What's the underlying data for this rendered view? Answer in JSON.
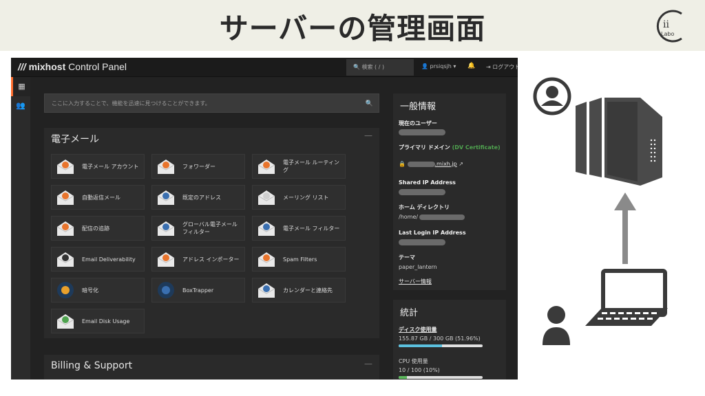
{
  "banner": {
    "title": "サーバーの管理画面",
    "logo_text": "Labo"
  },
  "topbar": {
    "brand": "mixhost",
    "brand_suffix": " Control Panel",
    "search_placeholder": "検索 ( / )",
    "user": "prsiqsjh",
    "logout": "ログアウト"
  },
  "quick_search": {
    "placeholder": "ここに入力することで、機能を迅速に見つけることができます。"
  },
  "email_panel": {
    "title": "電子メール",
    "tiles": [
      {
        "label": "電子メール アカウント",
        "icon": "email-accounts-icon"
      },
      {
        "label": "フォワーダー",
        "icon": "forwarders-icon"
      },
      {
        "label": "電子メール ルーティング",
        "icon": "email-routing-icon"
      },
      {
        "label": "自動返信メール",
        "icon": "autoresponders-icon"
      },
      {
        "label": "既定のアドレス",
        "icon": "default-address-icon"
      },
      {
        "label": "メーリング リスト",
        "icon": "mailing-lists-icon"
      },
      {
        "label": "配信の追跡",
        "icon": "track-delivery-icon"
      },
      {
        "label": "グローバル電子メール フィルター",
        "icon": "global-filters-icon"
      },
      {
        "label": "電子メール フィルター",
        "icon": "email-filters-icon"
      },
      {
        "label": "Email Deliverability",
        "icon": "deliverability-icon"
      },
      {
        "label": "アドレス インポーター",
        "icon": "address-importer-icon"
      },
      {
        "label": "Spam Filters",
        "icon": "spam-filters-icon"
      },
      {
        "label": "暗号化",
        "icon": "encryption-icon"
      },
      {
        "label": "BoxTrapper",
        "icon": "boxtrapper-icon"
      },
      {
        "label": "カレンダーと連絡先",
        "icon": "calendars-icon"
      },
      {
        "label": "Email Disk Usage",
        "icon": "disk-usage-icon"
      }
    ]
  },
  "billing_panel": {
    "title": "Billing & Support"
  },
  "general_info": {
    "title": "一般情報",
    "current_user_label": "現在のユーザー",
    "primary_domain_label": "プライマリ ドメイン",
    "dv_label": "(DV Certificate)",
    "domain_value": ".mixh.jp",
    "shared_ip_label": "Shared IP Address",
    "home_dir_label": "ホーム ディレクトリ",
    "home_dir_value": "/home/",
    "last_login_label": "Last Login IP Address",
    "theme_label": "テーマ",
    "theme_value": "paper_lantern",
    "server_info_link": "サーバー情報"
  },
  "stats": {
    "title": "統計",
    "disk_label": "ディスク使用量",
    "disk_value": "155.87 GB / 300 GB   (51.96%)",
    "disk_fraction": 0.5196,
    "cpu_label": "CPU 使用量",
    "cpu_value": "10 / 100   (10%)",
    "cpu_fraction": 0.1
  },
  "colors": {
    "accent": "#ff6c2c",
    "disk_bar": "#5bc0de",
    "cpu_bar": "#5cb85c"
  }
}
